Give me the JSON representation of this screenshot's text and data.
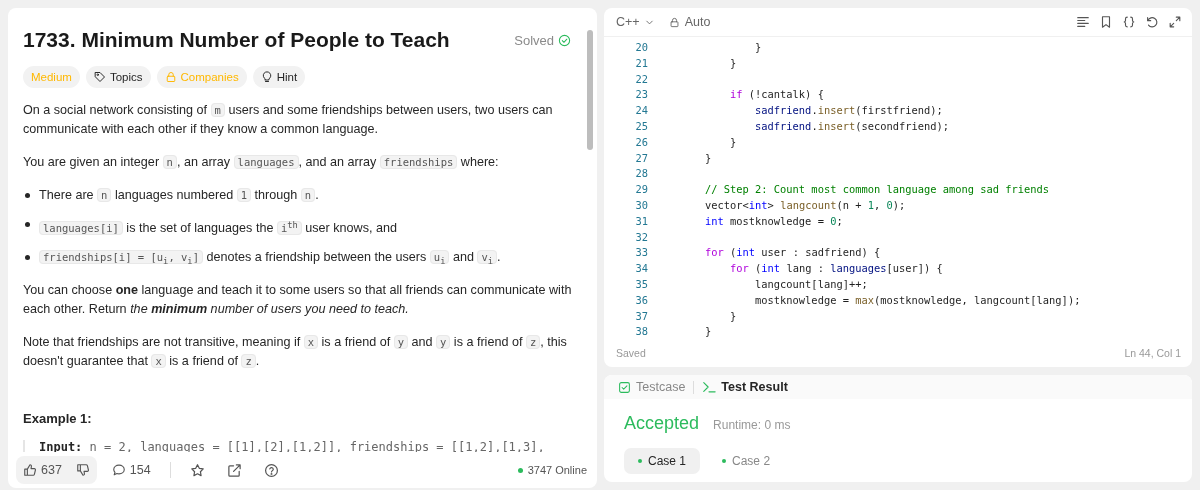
{
  "description": {
    "title": "1733. Minimum Number of People to Teach",
    "status": "Solved",
    "tags": [
      {
        "kind": "difficulty",
        "label": "Medium"
      },
      {
        "kind": "topics",
        "label": "Topics"
      },
      {
        "kind": "companies",
        "label": "Companies"
      },
      {
        "kind": "hint",
        "label": "Hint"
      }
    ],
    "blocks": [
      {
        "kind": "paragraph",
        "segments": [
          {
            "kind": "text",
            "text": "On a social network consisting of "
          },
          {
            "kind": "code",
            "text": "m"
          },
          {
            "kind": "text",
            "text": " users and some friendships between users, two users can communicate with each other if they know a common language."
          }
        ]
      },
      {
        "kind": "paragraph",
        "segments": [
          {
            "kind": "text",
            "text": "You are given an integer "
          },
          {
            "kind": "code",
            "text": "n"
          },
          {
            "kind": "text",
            "text": ", an array "
          },
          {
            "kind": "code",
            "text": "languages"
          },
          {
            "kind": "text",
            "text": ", and an array "
          },
          {
            "kind": "code",
            "text": "friendships"
          },
          {
            "kind": "text",
            "text": " where:"
          }
        ]
      },
      {
        "kind": "bullet",
        "segments": [
          {
            "kind": "text",
            "text": "There are "
          },
          {
            "kind": "code",
            "text": "n"
          },
          {
            "kind": "text",
            "text": " languages numbered "
          },
          {
            "kind": "code",
            "text": "1"
          },
          {
            "kind": "text",
            "text": " through "
          },
          {
            "kind": "code",
            "text": "n"
          },
          {
            "kind": "text",
            "text": "."
          }
        ]
      },
      {
        "kind": "bullet",
        "segments": [
          {
            "kind": "code",
            "text": "languages[i]"
          },
          {
            "kind": "text",
            "text": " is the set of languages the "
          },
          {
            "kind": "code",
            "text": "i$^{th}$"
          },
          {
            "kind": "text",
            "text": " user knows, and"
          }
        ]
      },
      {
        "kind": "bullet",
        "segments": [
          {
            "kind": "code",
            "text": "friendships[i] = [u$_{i}$, v$_{i}$]"
          },
          {
            "kind": "text",
            "text": " denotes a friendship between the users "
          },
          {
            "kind": "code",
            "text": "u$_{i}$"
          },
          {
            "kind": "text",
            "text": " and "
          },
          {
            "kind": "code",
            "text": "v$_{i}$"
          },
          {
            "kind": "text",
            "text": "."
          }
        ]
      },
      {
        "kind": "paragraph",
        "segments": [
          {
            "kind": "text",
            "text": "You can choose **one** language and teach it to some users so that all friends can communicate with each other. Return "
          },
          {
            "kind": "italic",
            "text": "the **minimum** number of users you need to teach."
          }
        ]
      },
      {
        "kind": "paragraph",
        "segments": [
          {
            "kind": "text",
            "text": "Note that friendships are not transitive, meaning if "
          },
          {
            "kind": "code",
            "text": "x"
          },
          {
            "kind": "text",
            "text": " is a friend of "
          },
          {
            "kind": "code",
            "text": "y"
          },
          {
            "kind": "text",
            "text": " and "
          },
          {
            "kind": "code",
            "text": "y"
          },
          {
            "kind": "text",
            "text": " is a friend of "
          },
          {
            "kind": "code",
            "text": "z"
          },
          {
            "kind": "text",
            "text": ", this doesn't guarantee that "
          },
          {
            "kind": "code",
            "text": "x"
          },
          {
            "kind": "text",
            "text": " is a friend of "
          },
          {
            "kind": "code",
            "text": "z"
          },
          {
            "kind": "text",
            "text": "."
          }
        ]
      },
      {
        "kind": "heading",
        "text": "Example 1:"
      },
      {
        "kind": "example",
        "label": "Input:",
        "text": "n = 2, languages = [[1],[2],[1,2]], friendships = [[1,2],[1,3],"
      }
    ],
    "footer": {
      "likes": "637",
      "comments": "154",
      "online": "3747 Online"
    }
  },
  "editor": {
    "language": "C++",
    "mode": "Auto",
    "lines": [
      {
        "num": "20",
        "tokens": [
          {
            "kind": "plain",
            "text": "            }"
          }
        ]
      },
      {
        "num": "21",
        "tokens": [
          {
            "kind": "plain",
            "text": "        }"
          }
        ]
      },
      {
        "num": "22"
      },
      {
        "num": "23",
        "tokens": [
          {
            "kind": "keyword",
            "text": "        if"
          },
          {
            "kind": "plain",
            "text": " (!cantalk) {"
          }
        ]
      },
      {
        "num": "24",
        "tokens": [
          {
            "kind": "variable",
            "text": "            sadfriend"
          },
          {
            "kind": "plain",
            "text": "."
          },
          {
            "kind": "function",
            "text": "insert"
          },
          {
            "kind": "plain",
            "text": "(firstfriend);"
          }
        ]
      },
      {
        "num": "25",
        "tokens": [
          {
            "kind": "variable",
            "text": "            sadfriend"
          },
          {
            "kind": "plain",
            "text": "."
          },
          {
            "kind": "function",
            "text": "insert"
          },
          {
            "kind": "plain",
            "text": "(secondfriend);"
          }
        ]
      },
      {
        "num": "26",
        "tokens": [
          {
            "kind": "plain",
            "text": "        }"
          }
        ]
      },
      {
        "num": "27",
        "tokens": [
          {
            "kind": "plain",
            "text": "    }"
          }
        ]
      },
      {
        "num": "28"
      },
      {
        "num": "29",
        "tokens": [
          {
            "kind": "comment",
            "text": "    // Step 2: Count most common language among sad friends"
          }
        ]
      },
      {
        "num": "30",
        "tokens": [
          {
            "kind": "plain",
            "text": "    vector<"
          },
          {
            "kind": "type",
            "text": "int"
          },
          {
            "kind": "plain",
            "text": "> "
          },
          {
            "kind": "function",
            "text": "langcount"
          },
          {
            "kind": "plain",
            "text": "(n + "
          },
          {
            "kind": "number",
            "text": "1"
          },
          {
            "kind": "plain",
            "text": ", "
          },
          {
            "kind": "number",
            "text": "0"
          },
          {
            "kind": "plain",
            "text": ");"
          }
        ]
      },
      {
        "num": "31",
        "tokens": [
          {
            "kind": "type",
            "text": "    int"
          },
          {
            "kind": "plain",
            "text": " mostknowledge = "
          },
          {
            "kind": "number",
            "text": "0"
          },
          {
            "kind": "plain",
            "text": ";"
          }
        ]
      },
      {
        "num": "32"
      },
      {
        "num": "33",
        "tokens": [
          {
            "kind": "keyword",
            "text": "    for"
          },
          {
            "kind": "plain",
            "text": " ("
          },
          {
            "kind": "type",
            "text": "int"
          },
          {
            "kind": "plain",
            "text": " user : sadfriend) {"
          }
        ]
      },
      {
        "num": "34",
        "tokens": [
          {
            "kind": "keyword",
            "text": "        for"
          },
          {
            "kind": "plain",
            "text": " ("
          },
          {
            "kind": "type",
            "text": "int"
          },
          {
            "kind": "plain",
            "text": " lang : "
          },
          {
            "kind": "variable",
            "text": "languages"
          },
          {
            "kind": "plain",
            "text": "[user]) {"
          }
        ]
      },
      {
        "num": "35",
        "tokens": [
          {
            "kind": "plain",
            "text": "            langcount[lang]++;"
          }
        ]
      },
      {
        "num": "36",
        "tokens": [
          {
            "kind": "plain",
            "text": "            mostknowledge = "
          },
          {
            "kind": "function",
            "text": "max"
          },
          {
            "kind": "plain",
            "text": "(mostknowledge, langcount[lang]);"
          }
        ]
      },
      {
        "num": "37",
        "tokens": [
          {
            "kind": "plain",
            "text": "        }"
          }
        ]
      },
      {
        "num": "38",
        "tokens": [
          {
            "kind": "plain",
            "text": "    }"
          }
        ]
      }
    ],
    "save_status": "Saved",
    "cursor": "Ln 44, Col 1"
  },
  "result": {
    "tabs": [
      {
        "kind": "testcase",
        "label": "Testcase",
        "selected": false
      },
      {
        "kind": "result",
        "label": "Test Result",
        "selected": true
      }
    ],
    "verdict": "Accepted",
    "runtime": "Runtime: 0 ms",
    "cases": [
      {
        "label": "Case 1",
        "selected": true
      },
      {
        "label": "Case 2",
        "selected": false
      }
    ]
  }
}
